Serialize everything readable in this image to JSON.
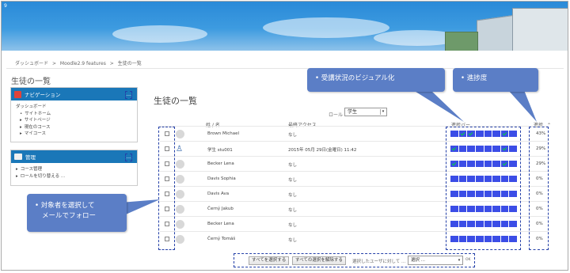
{
  "banner": {
    "version_text": "9"
  },
  "breadcrumb": [
    "ダッシュボード",
    ">",
    "Moodle2.9 features",
    ">",
    "生徒の一覧"
  ],
  "page_title": "生徒の一覧",
  "nav_block": {
    "title": "ナビゲーション",
    "items": [
      "ダッシュボード",
      "サイトホーム",
      "サイトページ",
      "現在のコース",
      "マイコース"
    ]
  },
  "admin_block": {
    "title": "管理",
    "items": [
      "コース管理",
      "ロールを切り替える ..."
    ]
  },
  "main": {
    "title": "生徒の一覧",
    "role_label": "ロール",
    "role_value": "学生",
    "headers": {
      "name": "姓 / 名",
      "last_access": "最終アクセス",
      "status_bar": "進捗バー",
      "progress": "進捗"
    },
    "sort_icon": "caret-up-icon"
  },
  "students": [
    {
      "name": "Brown Michael",
      "last_access": "なし",
      "progress": "43%",
      "bar": [
        0,
        1,
        1,
        0,
        0,
        0,
        1,
        0
      ]
    },
    {
      "name": "学生 stu001",
      "last_access": "2015年 05月 29日(金曜日) 11:42",
      "progress": "29%",
      "bar": [
        1,
        0,
        0,
        0,
        0,
        0,
        1,
        0
      ]
    },
    {
      "name": "Becker Lena",
      "last_access": "なし",
      "progress": "29%",
      "bar": [
        1,
        0,
        0,
        0,
        0,
        0,
        1,
        0
      ]
    },
    {
      "name": "Davis Sophia",
      "last_access": "なし",
      "progress": "0%",
      "bar": [
        0,
        0,
        0,
        0,
        0,
        0,
        0,
        0
      ]
    },
    {
      "name": "Davis Ava",
      "last_access": "なし",
      "progress": "0%",
      "bar": [
        0,
        0,
        0,
        0,
        0,
        0,
        0,
        0
      ]
    },
    {
      "name": "Černý Jakub",
      "last_access": "なし",
      "progress": "0%",
      "bar": [
        0,
        0,
        0,
        0,
        0,
        0,
        0,
        0
      ]
    },
    {
      "name": "Becker Lena",
      "last_access": "なし",
      "progress": "0%",
      "bar": [
        0,
        0,
        0,
        0,
        0,
        0,
        0,
        0
      ]
    },
    {
      "name": "Černý Tomáš",
      "last_access": "なし",
      "progress": "0%",
      "bar": [
        0,
        0,
        0,
        0,
        0,
        0,
        0,
        0
      ]
    }
  ],
  "footer": {
    "select_all": "すべてを選択する",
    "deselect_all": "すべての選択を解除する",
    "with_selected": "選択したユーザに対して ...",
    "action_select": "選択 ...",
    "ok_text": "OK"
  },
  "callouts": {
    "visual": "受講状況のビジュアル化",
    "progress": "進捗度",
    "follow_line1": "対象者を選択して",
    "follow_line2": "メールでフォロー"
  },
  "colors": {
    "header_blue": "#1a77b8",
    "bar_blue": "#3b4de6",
    "check_green": "#00d83a",
    "callout": "#5b7ec6",
    "dash_border": "#2440a8"
  }
}
